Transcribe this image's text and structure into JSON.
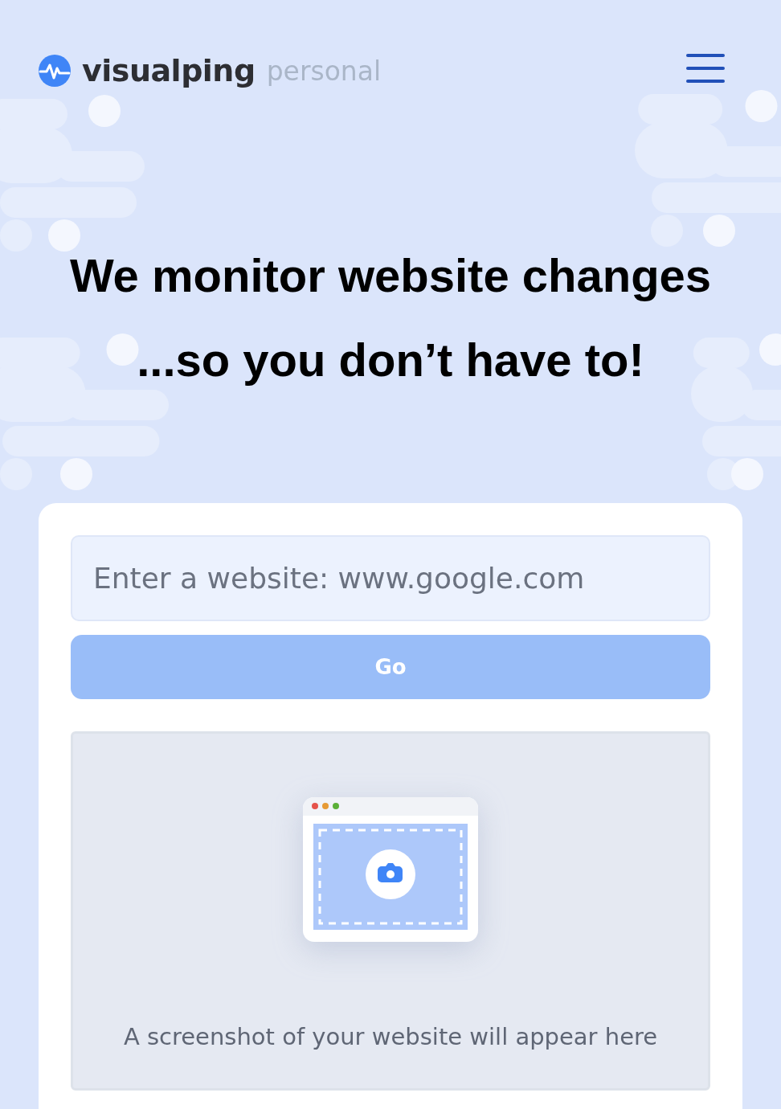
{
  "header": {
    "brand": "visualping",
    "plan": "personal"
  },
  "hero": {
    "lines": [
      "We monitor website changes",
      "...so you don’t have to!"
    ]
  },
  "form": {
    "url_field": {
      "placeholder": "Enter a website: www.google.com"
    },
    "go_button": {
      "label": "Go",
      "disabled": true
    },
    "preview": {
      "caption": "A screenshot of your website will appear here"
    }
  }
}
